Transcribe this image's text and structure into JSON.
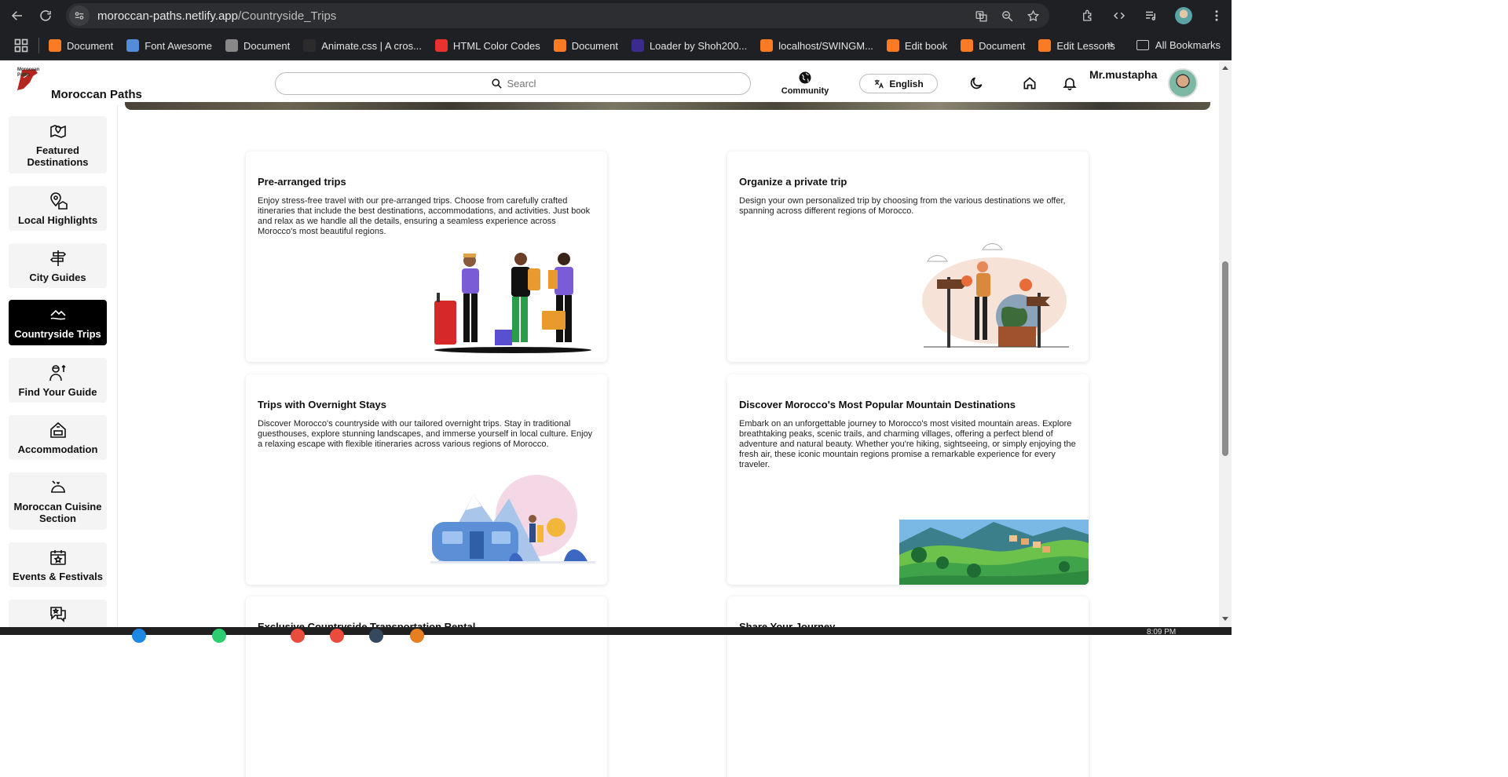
{
  "browser": {
    "url_host": "moroccan-paths.netlify.app",
    "url_path": "/Countryside_Trips",
    "bookmarks": [
      {
        "label": "Document",
        "icon": "xampp-icon",
        "color": "#fb7a24"
      },
      {
        "label": "Font Awesome",
        "icon": "flag-icon",
        "color": "#538dd7"
      },
      {
        "label": "Document",
        "icon": "globe-icon",
        "color": "#888888"
      },
      {
        "label": "Animate.css | A cros...",
        "icon": "animate-icon",
        "color": "#2b2b2b"
      },
      {
        "label": "HTML Color Codes",
        "icon": "color-icon",
        "color": "#e8322e"
      },
      {
        "label": "Document",
        "icon": "xampp-icon",
        "color": "#fb7a24"
      },
      {
        "label": "Loader by Shoh200...",
        "icon": "uiverse-icon",
        "color": "#3b2b8f"
      },
      {
        "label": "localhost/SWINGM...",
        "icon": "xampp-icon",
        "color": "#fb7a24"
      },
      {
        "label": "Edit book",
        "icon": "xampp-icon",
        "color": "#fb7a24"
      },
      {
        "label": "Document",
        "icon": "xampp-icon",
        "color": "#fb7a24"
      },
      {
        "label": "Edit Lessons",
        "icon": "xampp-icon",
        "color": "#fb7a24"
      }
    ],
    "all_bookmarks": "All Bookmarks"
  },
  "header": {
    "logo_small": "Moroccan\nPaths",
    "brand": "Moroccan Paths",
    "search_placeholder": "Search",
    "community": "Community",
    "language": "English",
    "username": "Mr.mustapha"
  },
  "sidebar": {
    "items": [
      {
        "label": "Featured Destinations",
        "icon": "map-pin-icon"
      },
      {
        "label": "Local Highlights",
        "icon": "location-building-icon"
      },
      {
        "label": "City Guides",
        "icon": "signpost-icon"
      },
      {
        "label": "Countryside Trips",
        "icon": "countryside-icon",
        "active": true
      },
      {
        "label": "Find Your Guide",
        "icon": "guide-icon"
      },
      {
        "label": "Accommodation",
        "icon": "house-icon"
      },
      {
        "label": "Moroccan Cuisine Section",
        "icon": "cloche-icon"
      },
      {
        "label": "Events & Festivals",
        "icon": "calendar-star-icon"
      },
      {
        "label": "",
        "icon": "chat-icon"
      }
    ]
  },
  "cards": [
    {
      "title": "Pre-arranged trips",
      "text": "Enjoy stress-free travel with our pre-arranged trips. Choose from carefully crafted itineraries that include the best destinations, accommodations, and activities. Just book and relax as we handle all the details, ensuring a seamless experience across Morocco's most beautiful regions."
    },
    {
      "title": "Organize a private trip",
      "text": "Design your own personalized trip by choosing from the various destinations we offer, spanning across different regions of Morocco."
    },
    {
      "title": "Trips with Overnight Stays",
      "text": "Discover Morocco's countryside with our tailored overnight trips. Stay in traditional guesthouses, explore stunning landscapes, and immerse yourself in local culture. Enjoy a relaxing escape with flexible itineraries across various regions of Morocco."
    },
    {
      "title": "Discover Morocco's Most Popular Mountain Destinations",
      "text": "Embark on an unforgettable journey to Morocco's most visited mountain areas. Explore breathtaking peaks, scenic trails, and charming villages, offering a perfect blend of adventure and natural beauty. Whether you're hiking, sightseeing, or simply enjoying the fresh air, these iconic mountain regions promise a remarkable experience for every traveler."
    },
    {
      "title": "Exclusive Countryside Transportation Rental",
      "text": ""
    },
    {
      "title": "Share Your Journey",
      "text": ""
    }
  ],
  "taskbar": {
    "clock": "8:09 PM"
  },
  "colors": {
    "accent": "#000000",
    "card_bg": "#ffffff",
    "sidebar_item_bg": "#f4f4f4"
  }
}
